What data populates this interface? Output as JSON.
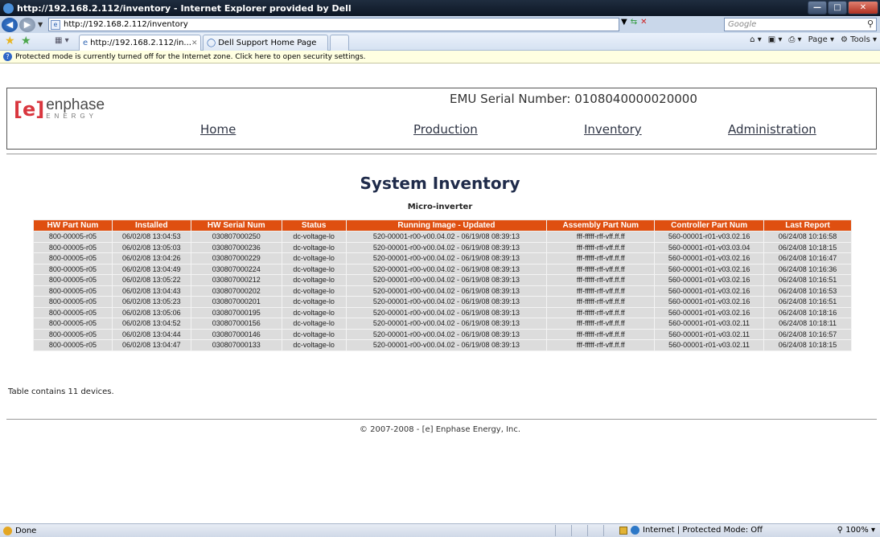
{
  "browser": {
    "title": "http://192.168.2.112/inventory - Internet Explorer provided by Dell",
    "address": "http://192.168.2.112/inventory",
    "search_placeholder": "Google",
    "tabs": [
      {
        "label": "http://192.168.2.112/in...",
        "active": true
      },
      {
        "label": "Dell Support Home Page",
        "active": false
      }
    ],
    "command_page": "Page",
    "command_tools": "Tools",
    "infobar": "Protected mode is currently turned off for the Internet zone.  Click here to open security settings.",
    "status": "Done",
    "zone": "Internet | Protected Mode: Off",
    "zoom": "100%"
  },
  "header": {
    "logo_bracket": "[e]",
    "logo_brand": "enphase",
    "logo_sub": "ENERGY",
    "serial": "EMU Serial Number: 0108040000020000",
    "nav": [
      "Home",
      "Production",
      "Inventory",
      "Administration"
    ]
  },
  "page": {
    "title": "System Inventory",
    "subtitle": "Micro-inverter",
    "device_count": "Table contains 11 devices.",
    "copyright": "© 2007-2008 - [e] Enphase Energy, Inc."
  },
  "table": {
    "columns": [
      "HW Part Num",
      "Installed",
      "HW Serial Num",
      "Status",
      "Running Image - Updated",
      "Assembly Part Num",
      "Controller Part Num",
      "Last Report"
    ],
    "rows": [
      [
        "800-00005-r05",
        "06/02/08 13:04:53",
        "030807000250",
        "dc-voltage-lo",
        "520-00001-r00-v00.04.02 - 06/19/08 08:39:13",
        "fff-fffff-rff-vff.ff.ff",
        "560-00001-r01-v03.02.16",
        "06/24/08 10:16:58"
      ],
      [
        "800-00005-r05",
        "06/02/08 13:05:03",
        "030807000236",
        "dc-voltage-lo",
        "520-00001-r00-v00.04.02 - 06/19/08 08:39:13",
        "fff-fffff-rff-vff.ff.ff",
        "560-00001-r01-v03.03.04",
        "06/24/08 10:18:15"
      ],
      [
        "800-00005-r05",
        "06/02/08 13:04:26",
        "030807000229",
        "dc-voltage-lo",
        "520-00001-r00-v00.04.02 - 06/19/08 08:39:13",
        "fff-fffff-rff-vff.ff.ff",
        "560-00001-r01-v03.02.16",
        "06/24/08 10:16:47"
      ],
      [
        "800-00005-r05",
        "06/02/08 13:04:49",
        "030807000224",
        "dc-voltage-lo",
        "520-00001-r00-v00.04.02 - 06/19/08 08:39:13",
        "fff-fffff-rff-vff.ff.ff",
        "560-00001-r01-v03.02.16",
        "06/24/08 10:16:36"
      ],
      [
        "800-00005-r05",
        "06/02/08 13:05:22",
        "030807000212",
        "dc-voltage-lo",
        "520-00001-r00-v00.04.02 - 06/19/08 08:39:13",
        "fff-fffff-rff-vff.ff.ff",
        "560-00001-r01-v03.02.16",
        "06/24/08 10:16:51"
      ],
      [
        "800-00005-r05",
        "06/02/08 13:04:43",
        "030807000202",
        "dc-voltage-lo",
        "520-00001-r00-v00.04.02 - 06/19/08 08:39:13",
        "fff-fffff-rff-vff.ff.ff",
        "560-00001-r01-v03.02.16",
        "06/24/08 10:16:53"
      ],
      [
        "800-00005-r05",
        "06/02/08 13:05:23",
        "030807000201",
        "dc-voltage-lo",
        "520-00001-r00-v00.04.02 - 06/19/08 08:39:13",
        "fff-fffff-rff-vff.ff.ff",
        "560-00001-r01-v03.02.16",
        "06/24/08 10:16:51"
      ],
      [
        "800-00005-r05",
        "06/02/08 13:05:06",
        "030807000195",
        "dc-voltage-lo",
        "520-00001-r00-v00.04.02 - 06/19/08 08:39:13",
        "fff-fffff-rff-vff.ff.ff",
        "560-00001-r01-v03.02.16",
        "06/24/08 10:18:16"
      ],
      [
        "800-00005-r05",
        "06/02/08 13:04:52",
        "030807000156",
        "dc-voltage-lo",
        "520-00001-r00-v00.04.02 - 06/19/08 08:39:13",
        "fff-fffff-rff-vff.ff.ff",
        "560-00001-r01-v03.02.11",
        "06/24/08 10:18:11"
      ],
      [
        "800-00005-r05",
        "06/02/08 13:04:44",
        "030807000146",
        "dc-voltage-lo",
        "520-00001-r00-v00.04.02 - 06/19/08 08:39:13",
        "fff-fffff-rff-vff.ff.ff",
        "560-00001-r01-v03.02.11",
        "06/24/08 10:16:57"
      ],
      [
        "800-00005-r05",
        "06/02/08 13:04:47",
        "030807000133",
        "dc-voltage-lo",
        "520-00001-r00-v00.04.02 - 06/19/08 08:39:13",
        "fff-fffff-rff-vff.ff.ff",
        "560-00001-r01-v03.02.11",
        "06/24/08 10:18:15"
      ]
    ]
  },
  "colors": {
    "table_header": "#df4f10",
    "row": "#dcdcdc",
    "logo_red": "#d9363e"
  }
}
